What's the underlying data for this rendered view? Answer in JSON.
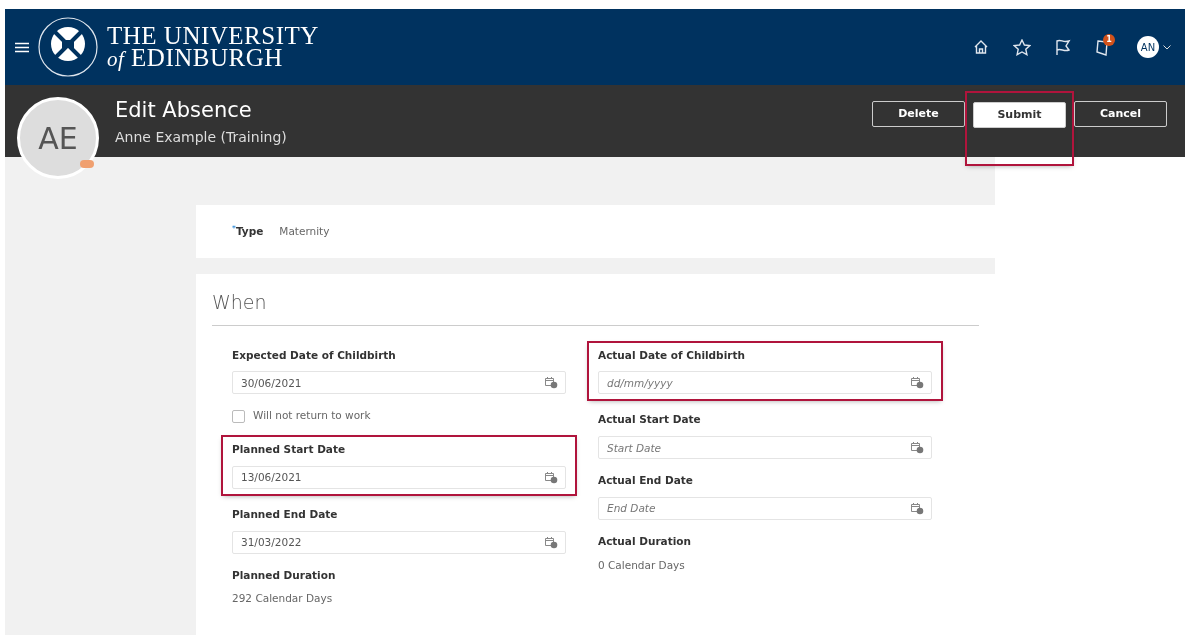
{
  "header": {
    "logo_line1": "THE UNIVERSITY",
    "logo_line2_prefix": "of",
    "logo_line2": "EDINBURGH",
    "notification_count": "1",
    "user_initials": "AN"
  },
  "page_header": {
    "avatar_initials": "AE",
    "title": "Edit Absence",
    "subtitle": "Anne Example (Training)",
    "buttons": [
      {
        "label": "Delete",
        "kind": "outline",
        "highlighted": false
      },
      {
        "label": "Submit",
        "kind": "primary",
        "highlighted": true
      },
      {
        "label": "Cancel",
        "kind": "outline",
        "highlighted": false
      }
    ]
  },
  "type_field": {
    "label": "Type",
    "required_mark": "*",
    "value": "Maternity"
  },
  "section": {
    "title": "When",
    "left": [
      {
        "kind": "date",
        "label": "Expected Date of Childbirth",
        "value": "30/06/2021",
        "highlighted": false
      },
      {
        "kind": "checkbox",
        "label": "Will not return to work",
        "checked": false
      },
      {
        "kind": "date",
        "label": "Planned Start Date",
        "value": "13/06/2021",
        "highlighted": true
      },
      {
        "kind": "date",
        "label": "Planned End Date",
        "value": "31/03/2022",
        "highlighted": false
      },
      {
        "kind": "readonly",
        "label": "Planned Duration",
        "value": "292 Calendar Days"
      }
    ],
    "right": [
      {
        "kind": "date",
        "label": "Actual Date of Childbirth",
        "placeholder": "dd/mm/yyyy",
        "highlighted": true
      },
      {
        "kind": "date",
        "label": "Actual Start Date",
        "placeholder": "Start Date",
        "highlighted": false
      },
      {
        "kind": "date",
        "label": "Actual End Date",
        "placeholder": "End Date",
        "highlighted": false
      },
      {
        "kind": "readonly",
        "label": "Actual Duration",
        "value": "0 Calendar Days"
      }
    ]
  }
}
